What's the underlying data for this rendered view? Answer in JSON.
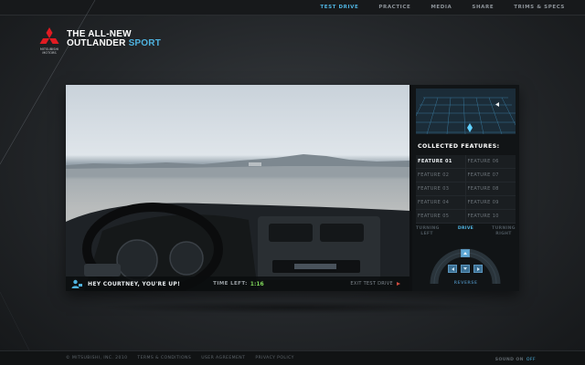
{
  "nav": {
    "items": [
      {
        "label": "TEST DRIVE",
        "active": true
      },
      {
        "label": "PRACTICE",
        "active": false
      },
      {
        "label": "MEDIA",
        "active": false
      },
      {
        "label": "SHARE",
        "active": false
      },
      {
        "label": "TRIMS & SPECS",
        "active": false
      }
    ]
  },
  "brand": {
    "logo_text": "MITSUBISHI MOTORS",
    "title_line1": "THE ALL-NEW",
    "title_line2_main": "OUTLANDER",
    "title_line2_accent": "SPORT",
    "accent_color": "#4fb3e0"
  },
  "video": {
    "greeting": "HEY COURTNEY, YOU'RE UP!",
    "time_left_label": "TIME LEFT:",
    "time_left_value": "1:16",
    "exit_label": "EXIT TEST DRIVE",
    "user_icon": "user-icon",
    "exit_icon": "red-arrow-icon"
  },
  "features": {
    "title": "COLLECTED FEATURES:",
    "items": [
      {
        "label": "FEATURE 01",
        "active": true
      },
      {
        "label": "FEATURE 06",
        "active": false
      },
      {
        "label": "FEATURE 02",
        "active": false
      },
      {
        "label": "FEATURE 07",
        "active": false
      },
      {
        "label": "FEATURE 03",
        "active": false
      },
      {
        "label": "FEATURE 08",
        "active": false
      },
      {
        "label": "FEATURE 04",
        "active": false
      },
      {
        "label": "FEATURE 09",
        "active": false
      },
      {
        "label": "FEATURE 05",
        "active": false
      },
      {
        "label": "FEATURE 10",
        "active": false
      }
    ]
  },
  "controls": {
    "turning_left": "TURNING\nLEFT",
    "drive": "DRIVE",
    "turning_right": "TURNING\nRIGHT",
    "reverse": "REVERSE"
  },
  "footer": {
    "copyright": "© MITSUBISHI, INC. 2010",
    "terms": "TERMS & CONDITIONS",
    "user_agreement": "USER AGREEMENT",
    "privacy": "PRIVACY POLICY",
    "sound_label": "SOUND ON",
    "sound_off": "OFF"
  }
}
